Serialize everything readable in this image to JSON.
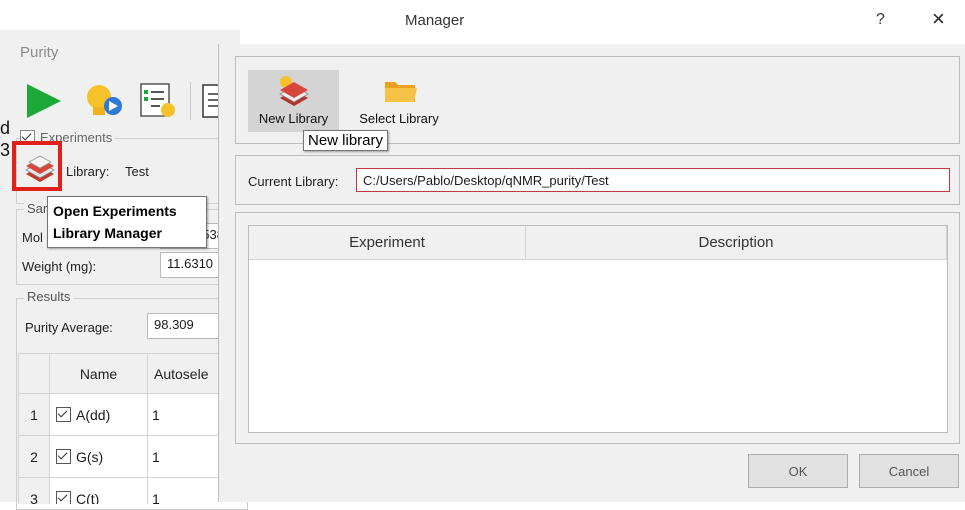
{
  "purity_window": {
    "title": "Purity",
    "toolbar": {
      "run_icon": "play-icon",
      "hint_icon": "lightbulb-icon",
      "checklist_icon": "checklist-icon",
      "report_icon": "document-icon"
    },
    "experiments_label": "Experiments",
    "library_label": "Library:",
    "library_value": "Test",
    "sample_group_label": "Sar",
    "mol_label": "Mol",
    "mol_value_partial": "2538",
    "weight_label": "Weight (mg):",
    "weight_value": "11.6310",
    "results_group_label": "Results",
    "purity_avg_label": "Purity Average:",
    "purity_avg_value": "98.309",
    "table": {
      "headers": [
        "",
        "Name",
        "Autosele"
      ],
      "rows": [
        {
          "num": "1",
          "name": "A(dd)",
          "value": "1"
        },
        {
          "num": "2",
          "name": "G(s)",
          "value": "1"
        },
        {
          "num": "3",
          "name": "C(t)",
          "value": "1"
        }
      ]
    },
    "tooltip": "Open Experiments\nLibrary Manager",
    "edge_chars": [
      "d",
      "3"
    ]
  },
  "dialog": {
    "title": "Manager",
    "help_label": "?",
    "close_label": "×",
    "toolbar": [
      {
        "label": "New Library",
        "icon": "books-icon"
      },
      {
        "label": "Select Library",
        "icon": "folder-icon"
      }
    ],
    "new_library_tooltip": "New library",
    "current_library_label": "Current Library:",
    "current_library_value": "C:/Users/Pablo/Desktop/qNMR_purity/Test",
    "table_headers": [
      "Experiment",
      "Description"
    ],
    "ok_label": "OK",
    "cancel_label": "Cancel"
  },
  "colors": {
    "highlight_red": "#e0201b",
    "run_green": "#1fa83a",
    "folder_yellow": "#f4b02c",
    "field_border_red": "#c0393b"
  }
}
